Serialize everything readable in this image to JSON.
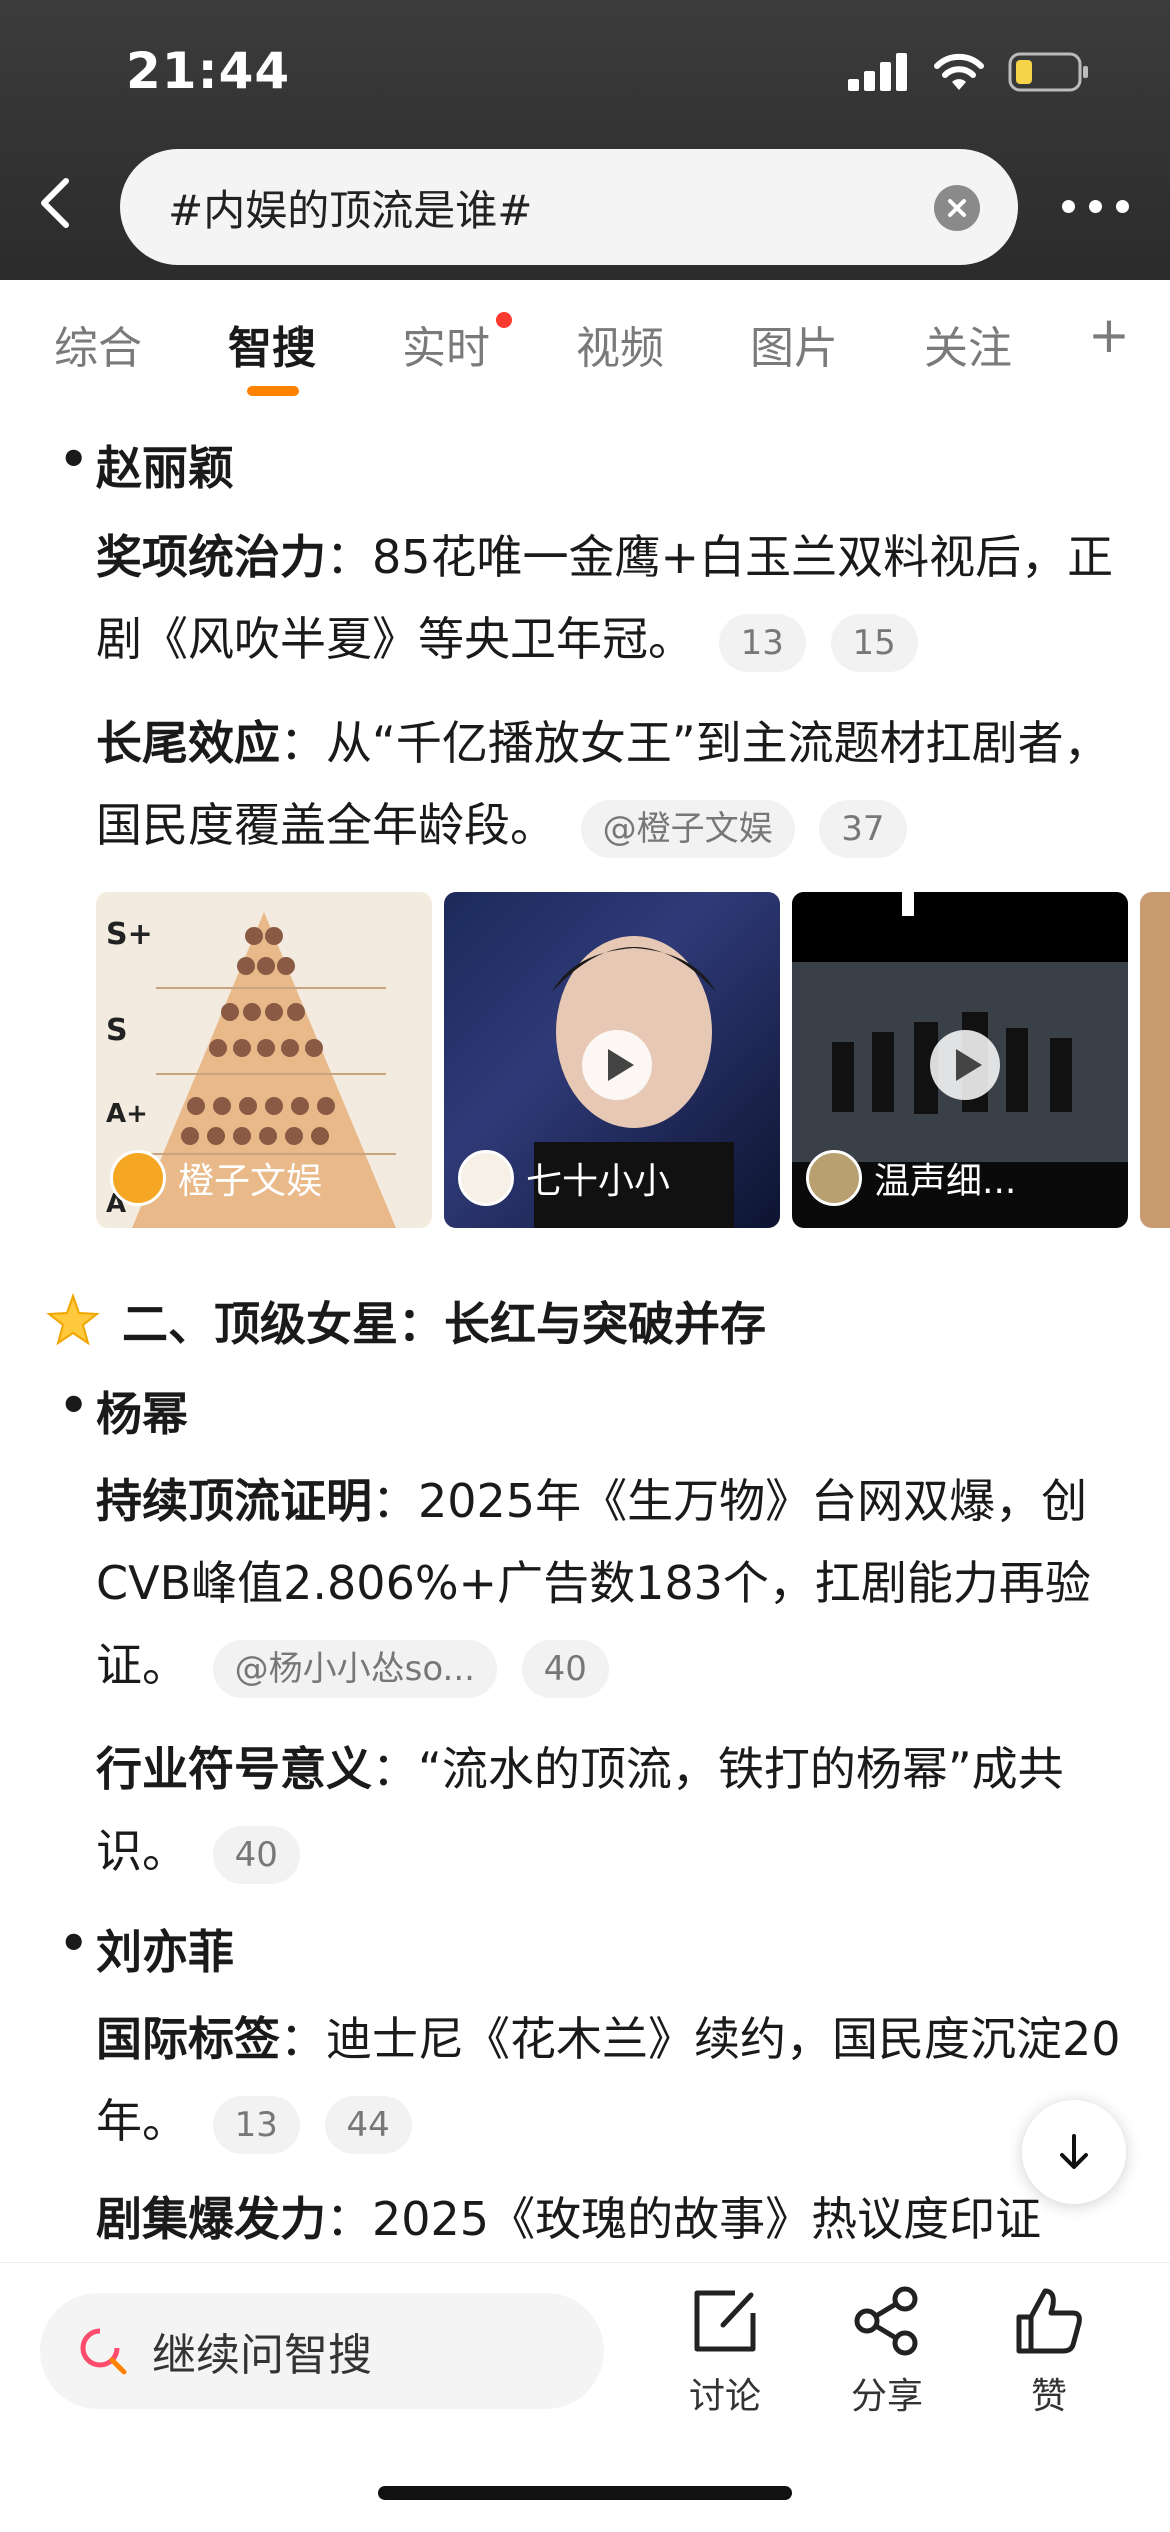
{
  "status": {
    "time": "21:44"
  },
  "search": {
    "query": "#内娱的顶流是谁#"
  },
  "tabs": [
    {
      "label": "综合"
    },
    {
      "label": "智搜"
    },
    {
      "label": "实时"
    },
    {
      "label": "视频"
    },
    {
      "label": "图片"
    },
    {
      "label": "关注"
    },
    {
      "label": "+"
    }
  ],
  "s1": {
    "name": "赵丽颖",
    "p1": {
      "title": "奖项统治力",
      "text": "：85花唯一金鹰+白玉兰双料视后，正剧《风吹半夏》等央卫年冠。",
      "tags": [
        "13",
        "15"
      ]
    },
    "p2": {
      "title": "长尾效应",
      "text": "：从“千亿播放女王”到主流题材扛剧者，国民度覆盖全年龄段。",
      "tags": [
        "@橙子文娱",
        "37"
      ]
    }
  },
  "cards": [
    {
      "author": "橙子文娱",
      "pyramid": [
        "S+",
        "S",
        "A+",
        "A"
      ]
    },
    {
      "author": "七十小小"
    },
    {
      "author": "温声细..."
    }
  ],
  "section2": {
    "title": "二、顶级女星：长红与突破并存"
  },
  "s2": {
    "name": "杨幂",
    "p1": {
      "title": "持续顶流证明",
      "text": "：2025年《生万物》台网双爆，创CVB峰值2.806%+广告数183个，扛剧能力再验证。",
      "tags": [
        "@杨小小怂so...",
        "40"
      ]
    },
    "p2": {
      "title": "行业符号意义",
      "text": "：“流水的顶流，铁打的杨幂”成共识。",
      "tags": [
        "40"
      ]
    }
  },
  "s3": {
    "name": "刘亦菲",
    "p1": {
      "title": "国际标签",
      "text": "：迪士尼《花木兰》续约，国民度沉淀20年。",
      "tags": [
        "13",
        "44"
      ]
    },
    "p2": {
      "title": "剧集爆发力",
      "text": "：2025《玫瑰的故事》热议度印证"
    }
  },
  "bottom": {
    "ask_placeholder": "继续问智搜",
    "discuss": "讨论",
    "share": "分享",
    "like": "赞"
  },
  "colors": {
    "accent": "#ff8200",
    "badge": "#ff3b30"
  }
}
